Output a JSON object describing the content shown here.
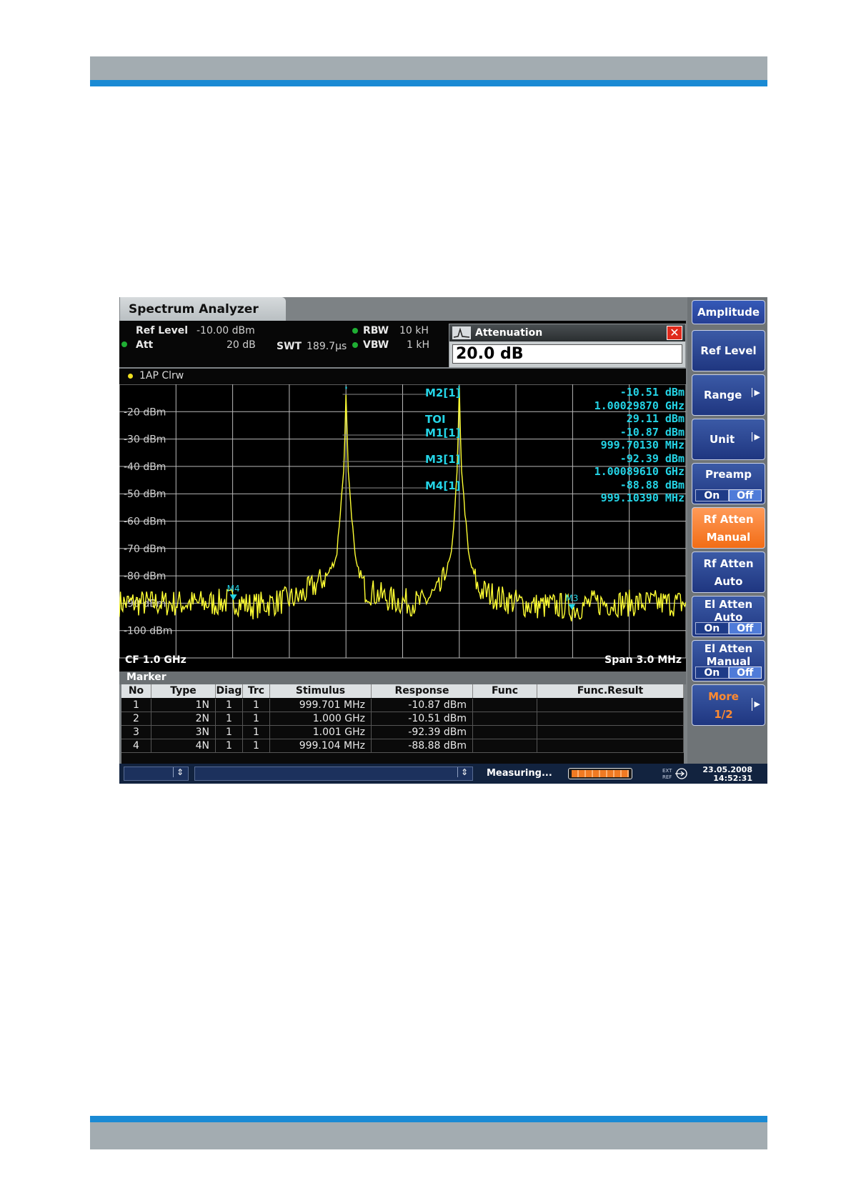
{
  "app": {
    "tab_title": "Spectrum Analyzer",
    "info": {
      "ref_level_label": "Ref Level",
      "ref_level_value": "-10.00 dBm",
      "att_label": "Att",
      "att_value": "20 dB",
      "swt_label": "SWT",
      "swt_value": "189.7µs",
      "rbw_label": "RBW",
      "rbw_value": "10 kH",
      "vbw_label": "VBW",
      "vbw_value": "1 kH"
    },
    "dialog": {
      "title": "Attenuation",
      "value": "20.0 dB"
    },
    "trace_label": "1AP Clrw",
    "marker_readout": {
      "m2_label": "M2[1]",
      "m2_level": "-10.51 dBm",
      "m2_freq": "1.00029870 GHz",
      "toi_label": "TOI",
      "toi_value": "29.11 dBm",
      "m1_label": "M1[1]",
      "m1_level": "-10.87 dBm",
      "m1_freq": "999.70130 MHz",
      "m3_label": "M3[1]",
      "m3_level": "-92.39 dBm",
      "m3_freq": "1.00089610 GHz",
      "m4_label": "M4[1]",
      "m4_level": "-88.88 dBm",
      "m4_freq": "999.10390 MHz"
    },
    "plot_markers": {
      "m4": "M4",
      "m3": "M3"
    },
    "cf": "CF 1.0 GHz",
    "span": "Span 3.0 MHz",
    "marker_title": "Marker",
    "table": {
      "headers": [
        "No",
        "Type",
        "Diag",
        "Trc",
        "Stimulus",
        "Response",
        "Func",
        "Func.Result"
      ],
      "rows": [
        [
          "1",
          "1N",
          "1",
          "1",
          "999.701 MHz",
          "-10.87 dBm",
          "",
          ""
        ],
        [
          "2",
          "2N",
          "1",
          "1",
          "1.000 GHz",
          "-10.51 dBm",
          "",
          ""
        ],
        [
          "3",
          "3N",
          "1",
          "1",
          "1.001 GHz",
          "-92.39 dBm",
          "",
          ""
        ],
        [
          "4",
          "4N",
          "1",
          "1",
          "999.104 MHz",
          "-88.88 dBm",
          "",
          ""
        ]
      ]
    },
    "softkeys": {
      "amplitude": "Amplitude",
      "ref_level": "Ref Level",
      "range": "Range",
      "unit": "Unit",
      "preamp": "Preamp",
      "rf_atten": "Rf Atten",
      "manual": "Manual",
      "auto": "Auto",
      "el_atten": "El Atten",
      "on": "On",
      "off": "Off",
      "more": "More",
      "page": "1/2"
    },
    "status": {
      "measuring": "Measuring...",
      "ext": "EXT",
      "ref": "REF",
      "date": "23.05.2008",
      "time": "14:52:31"
    },
    "colors": {
      "trace": "#ffff33",
      "marker_text": "#24d4e6",
      "grid": "#c8c8c8",
      "softkey_blue": "#2a4590",
      "softkey_orange": "#f27a2a"
    }
  },
  "chart_data": {
    "type": "line",
    "title": "",
    "xlabel": "",
    "ylabel": "",
    "center_frequency_GHz": 1.0,
    "span_MHz": 3.0,
    "x_range_MHz": [
      998.5,
      1001.5
    ],
    "y_range_dBm": [
      -110,
      -10
    ],
    "y_tick_labels": [
      "-20 dBm",
      "-30 dBm",
      "-40 dBm",
      "-50 dBm",
      "-60 dBm",
      "-70 dBm",
      "-80 dBm",
      "-90 dBm",
      "-100 dBm"
    ],
    "grid": true,
    "series": [
      {
        "x_MHz": [
          998.5,
          998.75,
          999.0,
          999.1,
          999.2,
          999.3,
          999.45,
          999.6,
          999.65,
          999.69,
          999.701,
          999.71,
          999.75,
          999.8,
          999.95,
          1000.1,
          1000.2,
          1000.26,
          1000.29,
          1000.3,
          1000.31,
          1000.35,
          1000.4,
          1000.55,
          1000.7,
          1000.85,
          1000.9,
          1001.0,
          1001.2,
          1001.5
        ],
        "y_dBm": [
          -90,
          -90,
          -90,
          -89,
          -91,
          -90,
          -88,
          -80,
          -73,
          -40,
          -10.87,
          -40,
          -75,
          -85,
          -89,
          -90,
          -85,
          -72,
          -40,
          -10.51,
          -40,
          -73,
          -85,
          -89,
          -91,
          -91,
          -92,
          -90,
          -90,
          -90
        ]
      }
    ],
    "markers": [
      {
        "name": "M1",
        "x_MHz": 999.701,
        "y_dBm": -10.87
      },
      {
        "name": "M2",
        "x_MHz": 1000.2987,
        "y_dBm": -10.51
      },
      {
        "name": "M3",
        "x_MHz": 1000.8961,
        "y_dBm": -92.39
      },
      {
        "name": "M4",
        "x_MHz": 999.1039,
        "y_dBm": -88.88
      }
    ]
  }
}
